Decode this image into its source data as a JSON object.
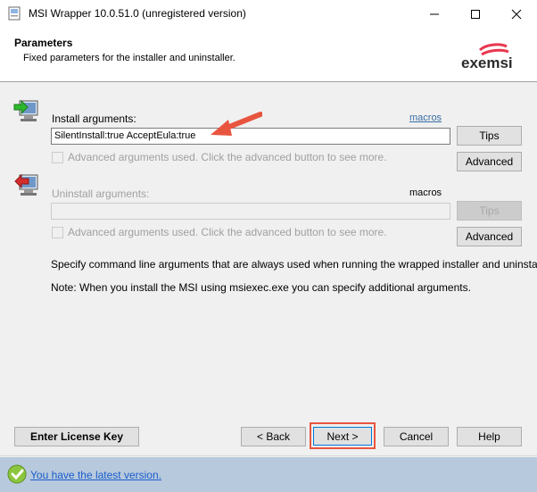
{
  "window": {
    "title": "MSI Wrapper 10.0.51.0 (unregistered version)",
    "minimize_glyph": "—",
    "maximize_glyph": "☐",
    "close_glyph": "✕"
  },
  "header": {
    "title": "Parameters",
    "subtitle": "Fixed parameters for the installer and uninstaller.",
    "logo_text": "exemsi",
    "logo_color": "#e8384f"
  },
  "install": {
    "label": "Install arguments:",
    "macros_link": "macros",
    "value": "SilentInstall:true AcceptEula:true",
    "tips_button": "Tips",
    "advanced_checkbox": "Advanced arguments used. Click the advanced button to see more.",
    "advanced_button": "Advanced"
  },
  "uninstall": {
    "label": "Uninstall arguments:",
    "macros_link": "macros",
    "value": "",
    "tips_button": "Tips",
    "advanced_checkbox": "Advanced arguments used. Click the advanced button to see more.",
    "advanced_button": "Advanced"
  },
  "help_text": {
    "line1": "Specify command line arguments that are always used when running the wrapped installer and uninstaller.",
    "line2": "Note: When you install the MSI using msiexec.exe you can specify additional arguments."
  },
  "footer": {
    "license_button": "Enter License Key",
    "back_button": "< Back",
    "next_button": "Next >",
    "cancel_button": "Cancel",
    "help_button": "Help"
  },
  "status": {
    "text": "You have the latest version.",
    "icon": "check-icon"
  },
  "colors": {
    "highlight": "#e8553f",
    "status_bar": "#b7c9dc",
    "link": "#1a5ccc"
  }
}
